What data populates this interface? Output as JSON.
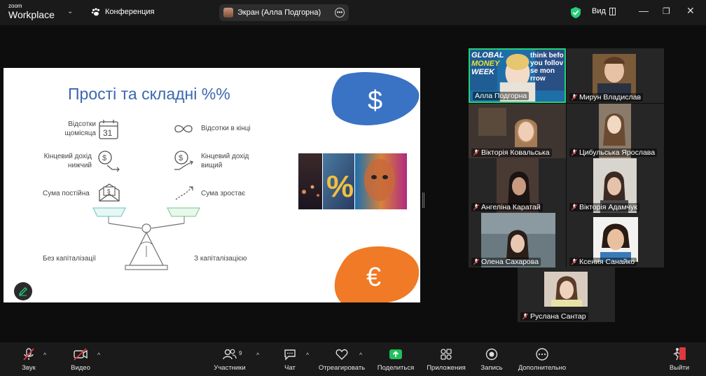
{
  "app": {
    "brand_small": "zoom",
    "brand_big": "Workplace",
    "meeting_name": "Конференция"
  },
  "screen_share": {
    "label": "Экран (Алла Подгорна)"
  },
  "view": {
    "label": "Вид"
  },
  "colors": {
    "accent_green": "#25d07a",
    "share_green": "#20c05c",
    "slide_blue": "#3a67b0",
    "blob_blue": "#3a72c4",
    "blob_orange": "#f07a25",
    "end_red": "#e0383e"
  },
  "slide": {
    "title": "Прості та складні %%",
    "left": [
      {
        "label": "Відсотки\nщомісяца",
        "icon": "calendar-31-icon",
        "icon_text": "31"
      },
      {
        "label": "Кінцевий дохід\nнижчий",
        "icon": "coin-down-arrow-icon"
      },
      {
        "label": "Сума постійна",
        "icon": "money-envelope-icon"
      }
    ],
    "right": [
      {
        "label": "Відсотки в кінці",
        "icon": "infinity-icon"
      },
      {
        "label": "Кінцевий дохід\nвищий",
        "icon": "coin-up-arrow-icon"
      },
      {
        "label": "Сума зростає",
        "icon": "growth-arrow-icon"
      }
    ],
    "bottom_left": "Без капіталізації",
    "bottom_right": "З капіталізацією",
    "dollar_symbol": "$",
    "euro_symbol": "€"
  },
  "participants": [
    {
      "name": "Алла Подгорна",
      "muted": false,
      "active": true,
      "banner": [
        "GLOBAL",
        "MONEY",
        "WEEK"
      ],
      "banner_right": [
        "think befo",
        "you follov",
        "se mon",
        "rrow"
      ]
    },
    {
      "name": "Мирун Владислав",
      "muted": true
    },
    {
      "name": "Вікторія Ковальська",
      "muted": true
    },
    {
      "name": "Цибульська Ярослава",
      "muted": true
    },
    {
      "name": "Ангеліна Каратай",
      "muted": true
    },
    {
      "name": "Вікторія Адамчук",
      "muted": true
    },
    {
      "name": "Олена Сахарова",
      "muted": true
    },
    {
      "name": "Ксения Санайко",
      "muted": true
    },
    {
      "name": "Руслана Сантар",
      "muted": true
    }
  ],
  "toolbar": {
    "audio": "Звук",
    "video": "Видео",
    "participants": "Участники",
    "participants_count": "9",
    "chat": "Чат",
    "react": "Отреагировать",
    "share": "Поделиться",
    "apps": "Приложения",
    "record": "Запись",
    "more": "Дополнительно",
    "leave": "Выйти"
  }
}
